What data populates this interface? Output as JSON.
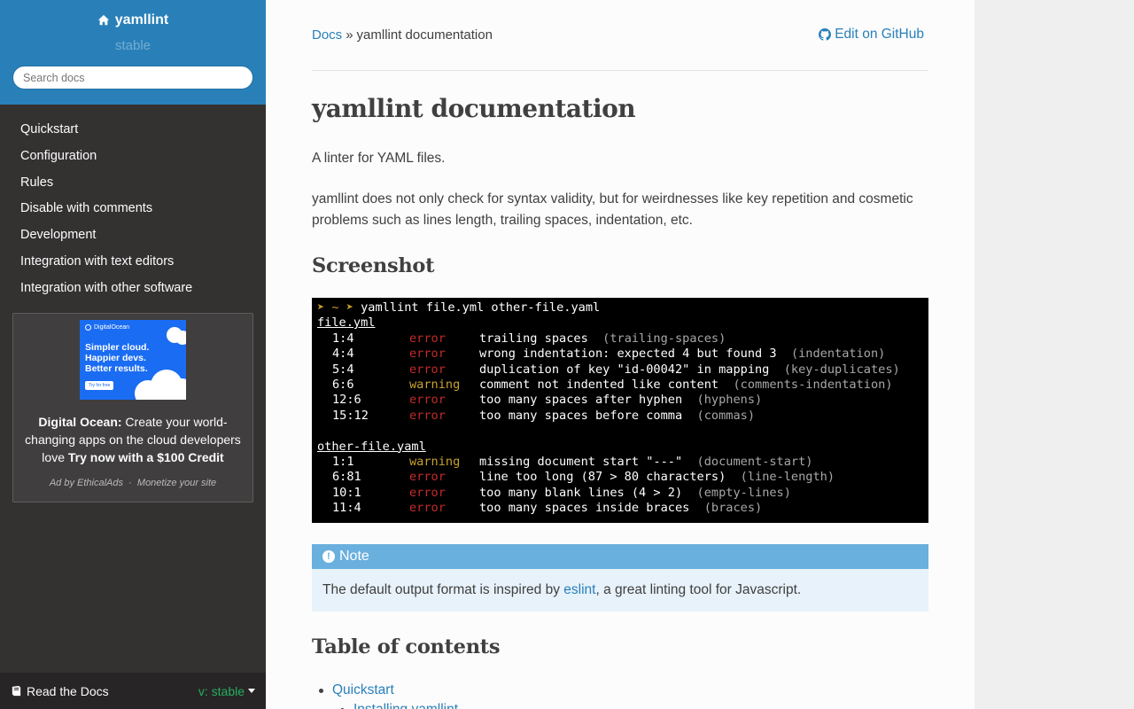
{
  "sidebar": {
    "project": "yamllint",
    "version": "stable",
    "search_placeholder": "Search docs",
    "nav": [
      "Quickstart",
      "Configuration",
      "Rules",
      "Disable with comments",
      "Development",
      "Integration with text editors",
      "Integration with other software"
    ],
    "ad": {
      "brand": "DigitalOcean",
      "image_text_1": "Simpler cloud.",
      "image_text_2": "Happier devs.",
      "image_text_3": "Better results.",
      "image_button": "Try for free",
      "sponsor": "Digital Ocean:",
      "copy": " Create your world-changing apps on the cloud developers love ",
      "cta": "Try now with a $100 Credit",
      "by": "Ad by EthicalAds",
      "sep": "·",
      "monetize": "Monetize your site"
    },
    "footer": {
      "label": "Read the Docs",
      "version": "v: stable"
    }
  },
  "breadcrumbs": {
    "home": "Docs",
    "sep": "»",
    "current": "yamllint documentation"
  },
  "edit_link": "Edit on GitHub",
  "content": {
    "title": "yamllint documentation",
    "intro": "A linter for YAML files.",
    "description": "yamllint does not only check for syntax validity, but for weirdnesses like key repetition and cosmetic problems such as lines length, trailing spaces, indentation, etc.",
    "screenshot_heading": "Screenshot",
    "terminal": {
      "prompt": "➤ ~ ➤",
      "command": " yamllint file.yml other-file.yaml",
      "files": [
        {
          "name": "file.yml",
          "rows": [
            {
              "pos": "1:4",
              "level": "error",
              "msg": "trailing spaces",
              "rule": "(trailing-spaces)"
            },
            {
              "pos": "4:4",
              "level": "error",
              "msg": "wrong indentation: expected 4 but found 3",
              "rule": "(indentation)"
            },
            {
              "pos": "5:4",
              "level": "error",
              "msg": "duplication of key \"id-00042\" in mapping",
              "rule": "(key-duplicates)"
            },
            {
              "pos": "6:6",
              "level": "warning",
              "msg": "comment not indented like content",
              "rule": "(comments-indentation)"
            },
            {
              "pos": "12:6",
              "level": "error",
              "msg": "too many spaces after hyphen",
              "rule": "(hyphens)"
            },
            {
              "pos": "15:12",
              "level": "error",
              "msg": "too many spaces before comma",
              "rule": "(commas)"
            }
          ]
        },
        {
          "name": "other-file.yaml",
          "rows": [
            {
              "pos": "1:1",
              "level": "warning",
              "msg": "missing document start \"---\"",
              "rule": "(document-start)"
            },
            {
              "pos": "6:81",
              "level": "error",
              "msg": "line too long (87 > 80 characters)",
              "rule": "(line-length)"
            },
            {
              "pos": "10:1",
              "level": "error",
              "msg": "too many blank lines (4 > 2)",
              "rule": "(empty-lines)"
            },
            {
              "pos": "11:4",
              "level": "error",
              "msg": "too many spaces inside braces",
              "rule": "(braces)"
            }
          ]
        }
      ]
    },
    "note": {
      "title": "Note",
      "before": "The default output format is inspired by ",
      "link": "eslint",
      "after": ", a great linting tool for Javascript."
    },
    "toc_heading": "Table of contents",
    "toc": [
      "Quickstart",
      "Installing yamllint"
    ]
  },
  "colors": {
    "accent": "#2980b9",
    "sidebar_bg": "#343131",
    "error": "#c42b2b",
    "warning": "#c8a22e",
    "note": "#6ab0de"
  }
}
